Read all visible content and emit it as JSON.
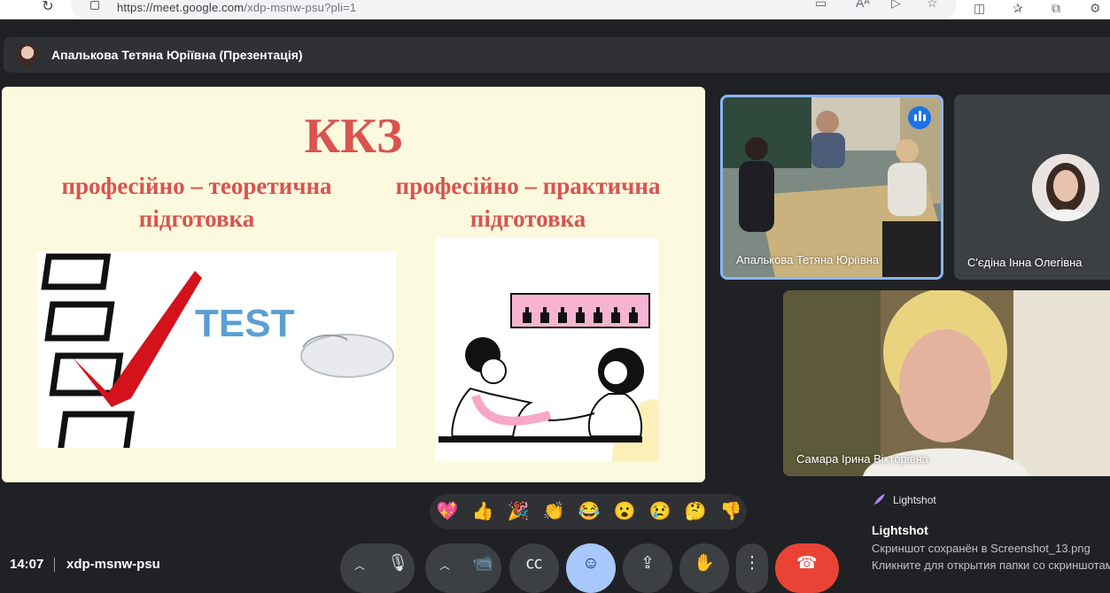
{
  "browser": {
    "url_host": "https://meet.google.com",
    "url_path": "/xdp-msnw-psu?pli=1"
  },
  "presenter_bar": {
    "label": "Апалькова Тетяна Юріївна (Презентація)"
  },
  "slide": {
    "title": "ККЗ",
    "left_heading_line1": "професійно – теоретична",
    "left_heading_line2": "підготовка",
    "right_heading_line1": "професійно – практична",
    "right_heading_line2": "підготовка",
    "test_word": "TEST"
  },
  "participants": [
    {
      "name": "Апалькова Тетяна Юріївна",
      "speaking": true
    },
    {
      "name": "С'єдіна Інна Олегівна",
      "speaking": false
    },
    {
      "name": "Самара Ірина Вікторівна",
      "speaking": false
    }
  ],
  "reactions": [
    "💖",
    "👍",
    "🎉",
    "👏",
    "😂",
    "😮",
    "😢",
    "🤔",
    "👎"
  ],
  "notification": {
    "app": "Lightshot",
    "heading": "Lightshot",
    "line1": "Скриншот сохранён в Screenshot_13.png",
    "line2": "Кликните для открытия папки со скриншотами"
  },
  "meeting": {
    "time": "14:07",
    "code": "xdp-msnw-psu"
  },
  "colors": {
    "slide_bg": "#fcfade",
    "slide_text": "#d9534f",
    "active_speaker_border": "#8ab4f8",
    "end_call": "#ea4335",
    "reactions_active": "#a8c7fa"
  }
}
